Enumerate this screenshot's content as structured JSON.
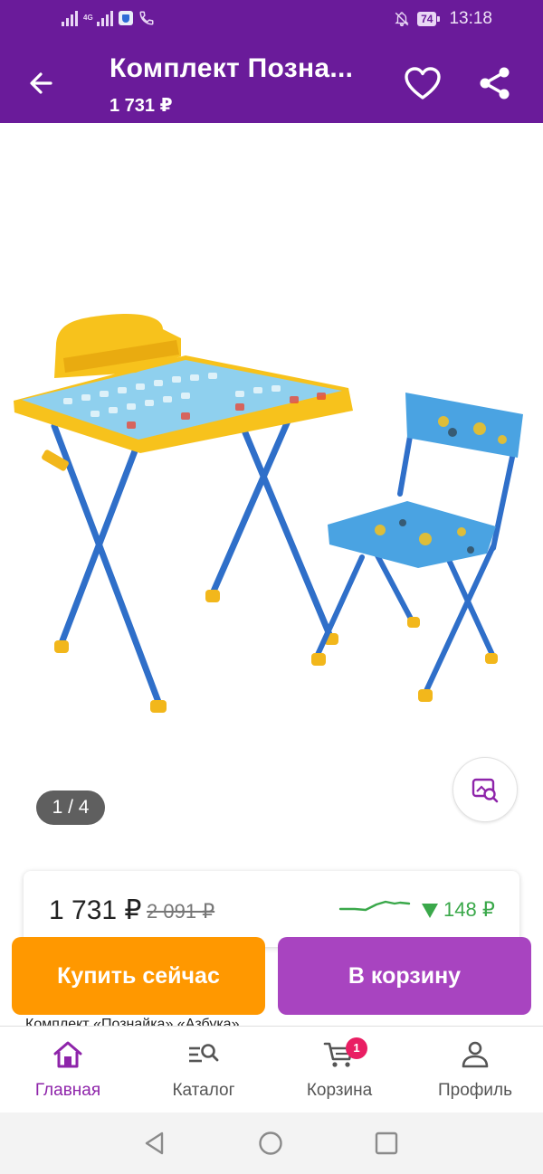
{
  "status_bar": {
    "network": "4G",
    "battery": "74",
    "time": "13:18"
  },
  "header": {
    "title": "Комплект Позна...",
    "price": "1 731 ₽"
  },
  "gallery": {
    "counter": "1 / 4"
  },
  "price_card": {
    "price": "1 731 ₽",
    "old_price": "2 091 ₽",
    "drop": "148 ₽",
    "trend_color": "#3aa84a"
  },
  "description_peek": "Комплект «Познайка» «Азбука»",
  "actions": {
    "buy_now": "Купить сейчас",
    "add_to_cart": "В корзину"
  },
  "bottom_nav": {
    "items": [
      {
        "label": "Главная",
        "icon": "home-icon",
        "active": true
      },
      {
        "label": "Каталог",
        "icon": "catalog-search-icon"
      },
      {
        "label": "Корзина",
        "icon": "cart-icon",
        "badge": "1"
      },
      {
        "label": "Профиль",
        "icon": "profile-icon"
      }
    ]
  },
  "colors": {
    "brand": "#6a1b9a",
    "buy_now": "#ff9800",
    "add_to_cart": "#a844c0",
    "active_nav": "#8e24aa"
  }
}
